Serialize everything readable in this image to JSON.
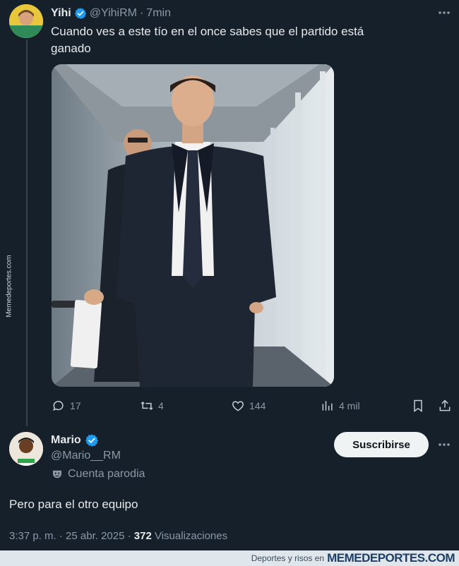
{
  "tweet": {
    "author_name": "Yihi",
    "author_handle": "@YihiRM",
    "sep": "·",
    "time": "7min",
    "text_line1": "Cuando ves a este tío en el once sabes que el partido está",
    "text_line2": "ganado",
    "actions": {
      "replies": "17",
      "retweets": "4",
      "likes": "144",
      "views": "4 mil"
    }
  },
  "reply": {
    "author_name": "Mario",
    "author_handle": "@Mario__RM",
    "badge_label": "Cuenta parodia",
    "subscribe_label": "Suscribirse",
    "text": "Pero para el otro equipo",
    "timestamp": "3:37 p. m. · 25 abr. 2025 · ",
    "views_count": "372",
    "views_label": " Visualizaciones"
  },
  "watermark": {
    "side_text": "Memedeportes.com",
    "footer_small": "Deportes y risos en",
    "footer_brand": "MEMEDEPORTES.COM"
  },
  "colors": {
    "background": "#15202b",
    "verified": "#1d9bf0",
    "muted": "#8b98a5"
  }
}
